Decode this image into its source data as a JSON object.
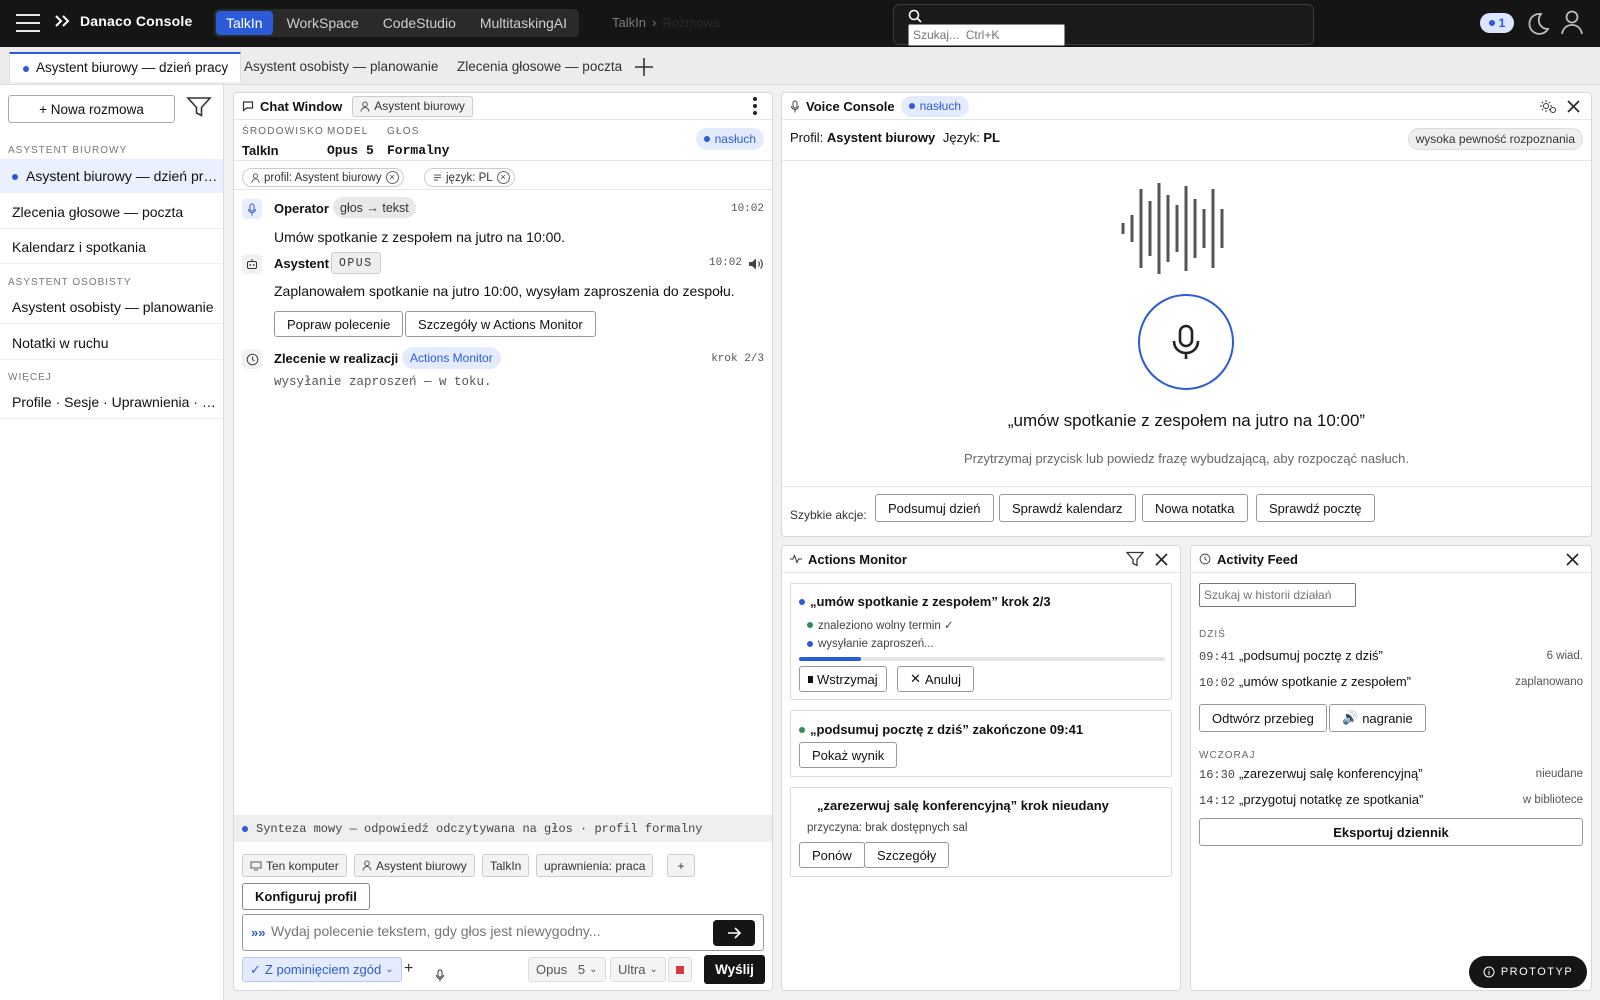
{
  "app": {
    "title": "Danaco Console"
  },
  "app_tabs": [
    {
      "label": "TalkIn",
      "active": true
    },
    {
      "label": "WorkSpace",
      "active": false
    },
    {
      "label": "CodeStudio",
      "active": false
    },
    {
      "label": "MultitaskingAI",
      "active": false
    }
  ],
  "breadcrumb": {
    "root": "TalkIn",
    "current": "Rozmowa"
  },
  "search": {
    "placeholder": "Szukaj...  Ctrl+K"
  },
  "notifications": {
    "count": "1"
  },
  "session_tabs": [
    {
      "label": "Asystent biurowy — dzień pracy",
      "active": true
    },
    {
      "label": "Asystent osobisty — planowanie",
      "active": false
    },
    {
      "label": "Zlecenia głosowe — poczta",
      "active": false
    }
  ],
  "sidebar": {
    "new_conversation": "+ Nowa rozmowa",
    "sections": [
      {
        "title": "ASYSTENT BIUROWY",
        "items": [
          "Asystent biurowy — dzień pracy",
          "Zlecenia głosowe — poczta",
          "Kalendarz i spotkania"
        ]
      },
      {
        "title": "ASYSTENT OSOBISTY",
        "items": [
          "Asystent osobisty — planowanie",
          "Notatki w ruchu"
        ]
      },
      {
        "title": "WIĘCEJ",
        "items": [
          "Profile · Sesje · Uprawnienia · Ustawienia"
        ]
      }
    ]
  },
  "chat": {
    "title": "Chat Window",
    "profile_chip": "Asystent biurowy",
    "env": {
      "env_label": "ŚRODOWISKO",
      "env_value": "TalkIn",
      "model_label": "MODEL",
      "model_value": "Opus 5",
      "voice_label": "GŁOS",
      "voice_value": "Formalny"
    },
    "status": "nasłuch",
    "filters": [
      "profil: Asystent biurowy",
      "język: PL"
    ],
    "messages": [
      {
        "author": "Operator",
        "badge": "głos → tekst",
        "time": "10:02",
        "text": "Umów spotkanie z zespołem na jutro na 10:00."
      },
      {
        "author": "Asystent",
        "badge": "OPUS",
        "time": "10:02",
        "text": "Zaplanowałem spotkanie na jutro 10:00, wysyłam zaproszenia do zespołu.",
        "actions": [
          "Popraw polecenie",
          "Szczegóły w Actions Monitor"
        ]
      },
      {
        "author": "Zlecenie w realizacji",
        "badge": "Actions Monitor",
        "time": "krok 2/3",
        "text": "wysyłanie zaproszeń — w toku."
      }
    ],
    "synth_bar": "Synteza mowy — odpowiedź odczytywana na głos · profil formalny",
    "context_chips": [
      "Ten komputer",
      "Asystent biurowy",
      "TalkIn",
      "uprawnienia: praca",
      "+"
    ],
    "configure_profile": "Konfiguruj profil",
    "input": {
      "placeholder": "Wydaj polecenie tekstem, gdy głos jest niewygodny...",
      "prefix": "»»"
    },
    "controls": {
      "consent": "Z pominięciem zgód",
      "model": "Opus   5",
      "quality": "Ultra",
      "send": "Wyślij"
    }
  },
  "voice": {
    "title": "Voice Console",
    "status": "nasłuch",
    "profile_label": "Profil:",
    "profile_value": "Asystent biurowy",
    "language_label": "Język:",
    "language_value": "PL",
    "confidence": "wysoka pewność rozpoznania",
    "transcript": "„umów spotkanie z zespołem na jutro na 10:00”",
    "hint": "Przytrzymaj przycisk lub powiedz frazę wybudzającą, aby rozpocząć nasłuch.",
    "quick_label": "Szybkie akcje:",
    "quick_actions": [
      "Podsumuj dzień",
      "Sprawdź kalendarz",
      "Nowa notatka",
      "Sprawdź pocztę"
    ]
  },
  "actions_monitor": {
    "title": "Actions Monitor",
    "cards": [
      {
        "title": "„umów spotkanie z zespołem” krok 2/3",
        "dot_color": "#2b5bd7",
        "steps": [
          {
            "text": "znaleziono wolny termin ✓",
            "dot_color": "#2e8b57"
          },
          {
            "text": "wysyłanie zaproszeń...",
            "dot_color": "#2b5bd7"
          }
        ],
        "progress": 0.17,
        "buttons": [
          "Wstrzymaj",
          "Anuluj"
        ]
      },
      {
        "title": "„podsumuj pocztę z dziś” zakończone 09:41",
        "dot_color": "#2e8b57",
        "buttons": [
          "Pokaż wynik"
        ]
      },
      {
        "title": "„zarezerwuj salę konferencyjną” krok nieudany",
        "reason": "przyczyna: brak dostępnych sal",
        "buttons": [
          "Ponów",
          "Szczegóły"
        ]
      }
    ]
  },
  "activity": {
    "title": "Activity Feed",
    "search_placeholder": "Szukaj w historii działań",
    "today_label": "DZIŚ",
    "today": [
      {
        "time": "09:41",
        "text": "„podsumuj pocztę z dziś”",
        "status": "6 wiad."
      },
      {
        "time": "10:02",
        "text": "„umów spotkanie z zespołem”",
        "status": "zaplanowano"
      }
    ],
    "buttons": [
      "Odtwórz przebieg",
      "nagranie"
    ],
    "yesterday_label": "WCZORAJ",
    "yesterday": [
      {
        "time": "16:30",
        "text": "„zarezerwuj salę konferencyjną”",
        "status": "nieudane"
      },
      {
        "time": "14:12",
        "text": "„przygotuj notatkę ze spotkania”",
        "status": "w bibliotece"
      }
    ],
    "export": "Eksportuj dziennik"
  },
  "badge": {
    "prototype": "PROTOTYP"
  },
  "colors": {
    "accent": "#2b5bd7",
    "topbar": "#151515",
    "success": "#2e8b57"
  }
}
